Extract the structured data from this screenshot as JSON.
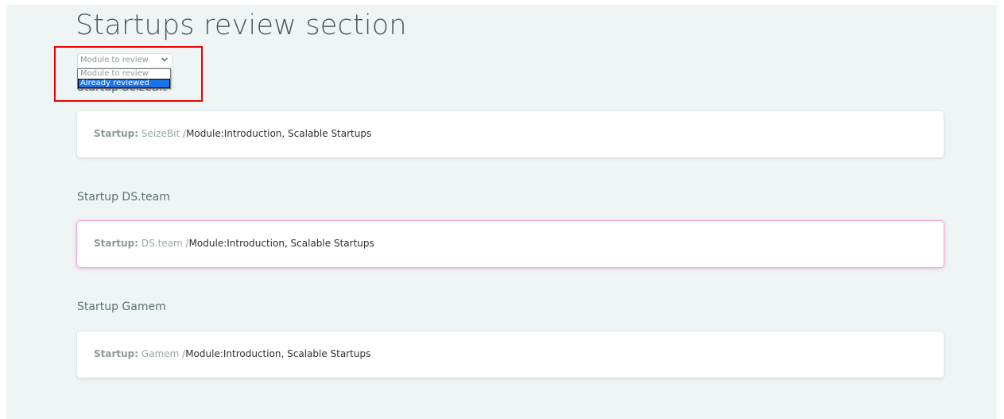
{
  "page": {
    "title": "Startups review section"
  },
  "filter": {
    "selected": "Module to review",
    "options": [
      "Module to review",
      "Already reviewed"
    ],
    "highlighted_option": "Already reviewed"
  },
  "sections": [
    {
      "heading": "Startup SeizeBit",
      "card": {
        "label": "Startup:",
        "startup_name": "SeizeBit",
        "separator": "/",
        "module": "Module:Introduction, Scalable Startups"
      }
    },
    {
      "heading": "Startup DS.team",
      "card": {
        "label": "Startup:",
        "startup_name": "DS.team",
        "separator": "/",
        "module": "Module:Introduction, Scalable Startups"
      }
    },
    {
      "heading": "Startup Gamem",
      "card": {
        "label": "Startup:",
        "startup_name": "Gamem",
        "separator": "/",
        "module": "Module:Introduction, Scalable Startups"
      }
    }
  ],
  "colors": {
    "background": "#eff4f4",
    "card": "#ffffff",
    "heading": "#485c5f",
    "selection": "#1a73e8",
    "highlight_box": "#f00000",
    "active_card_glow": "#f3a3d0"
  },
  "icons": {
    "dropdown_indicator": "chevron-down-icon"
  }
}
